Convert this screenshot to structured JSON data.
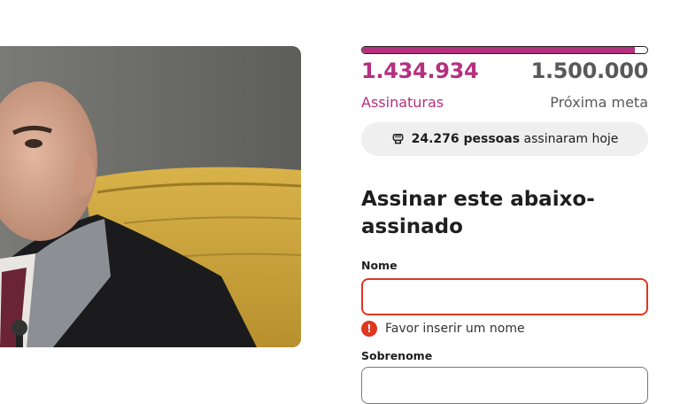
{
  "petition": {
    "progress_fraction": 0.957,
    "signatures_count": "1.434.934",
    "signatures_label": "Assinaturas",
    "goal_count": "1.500.000",
    "goal_label": "Próxima meta",
    "today_strong": "24.276 pessoas",
    "today_rest": "assinaram hoje",
    "today_icon": "raised-fist-icon"
  },
  "form": {
    "title": "Assinar este abaixo-assinado",
    "first_name_label": "Nome",
    "first_name_value": "",
    "first_name_error": "Favor inserir um nome",
    "last_name_label": "Sobrenome"
  },
  "colors": {
    "brand": "#b5307f",
    "error": "#e0371f",
    "muted": "#595959"
  }
}
